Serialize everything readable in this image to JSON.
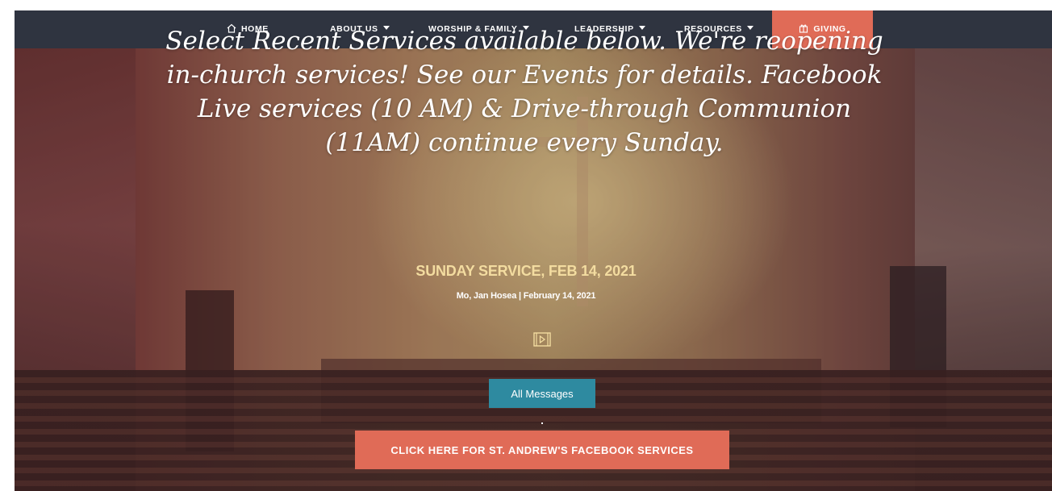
{
  "nav": {
    "home": "HOME",
    "about": "ABOUT US",
    "worship": "WORSHIP & FAMILY",
    "leadership": "LEADERSHIP",
    "resources": "RESOURCES",
    "giving": "GIVING",
    "home_icon": "home-icon",
    "giving_icon": "gift-icon"
  },
  "hero": {
    "headline": "Select Recent Services available below. We're reopening in-church services! See our Events for details. Facebook Live services (10 AM) & Drive-through Communion (11AM) continue every Sunday.",
    "service_title": "SUNDAY SERVICE, FEB 14, 2021",
    "service_meta": "Mo, Jan Hosea | February 14, 2021",
    "video_icon": "video-icon",
    "all_messages": "All Messages",
    "facebook_button": "CLICK HERE FOR ST. ANDREW'S FACEBOOK SERVICES"
  },
  "colors": {
    "nav_bg": "#2f3440",
    "accent": "#e06b57",
    "teal_button": "#2e8aa0",
    "service_title": "#f3dca0"
  }
}
